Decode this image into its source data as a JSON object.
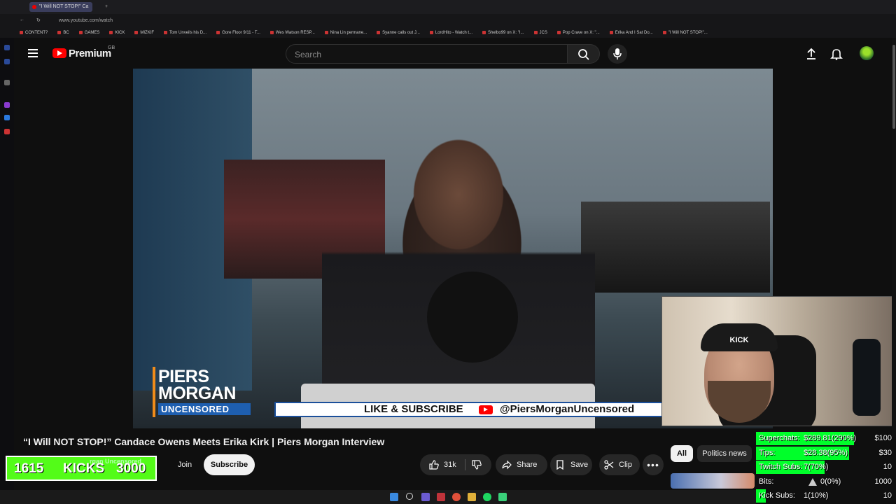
{
  "browser": {
    "tab_title": "\"I Will NOT STOP!\" Ca",
    "url": "www.youtube.com/watch",
    "bookmarks": [
      "CONTENT?",
      "BC",
      "GAMES",
      "KICK",
      "MIZKIF",
      "Tom Unveils his D...",
      "Gore Floor 9/11 - T...",
      "Wes Watson RESP...",
      "Nina Lin permane...",
      "Syanne calls out J...",
      "LordHito - Watch t...",
      "Shelbo99 on X: \"I...",
      "JCS",
      "Pop Crave on X: \"...",
      "Erika And I Sat Do...",
      "\"I Will NOT STOP!\"..."
    ]
  },
  "header": {
    "brand": "Premium",
    "region": "GB",
    "search_placeholder": "Search"
  },
  "video": {
    "logo_line1": "PIERS",
    "logo_line2": "MORGAN",
    "logo_line3": "UNCENSORED",
    "banner_text": "LIKE & SUBSCRIBE",
    "banner_handle": "@PiersMorganUncensored"
  },
  "webcam": {
    "hat_text": "KICK"
  },
  "watch": {
    "title": "“I Will NOT STOP!” Candace Owens Meets Erika Kirk | Piers Morgan Interview",
    "channel_overlay": "rgan Uncensored",
    "join_label": "Join",
    "subscribe_label": "Subscribe",
    "likes": "31k",
    "share_label": "Share",
    "save_label": "Save",
    "clip_label": "Clip"
  },
  "kicks": {
    "count": "1615",
    "label": "KICKS",
    "goal": "3000"
  },
  "chips": {
    "all": "All",
    "politics": "Politics news"
  },
  "stats": [
    {
      "label": "Superchats:",
      "value": "$289.81(290%)",
      "goal": "$100",
      "fill": 1.0
    },
    {
      "label": "Tips:",
      "value": "$28.38(95%)",
      "goal": "$30",
      "fill": 0.95
    },
    {
      "label": "Twitch Subs:",
      "value": "7(70%)",
      "goal": "10",
      "fill": 0.7
    },
    {
      "label": "Bits:",
      "value": "0(0%)",
      "goal": "1000",
      "fill": 0.0
    },
    {
      "label": "Kick Subs:",
      "value": "1(10%)",
      "goal": "10",
      "fill": 0.1
    }
  ],
  "colors": {
    "youtube_red": "#ff0000",
    "kick_green": "#53fc18",
    "stat_green": "#00ff2a"
  }
}
